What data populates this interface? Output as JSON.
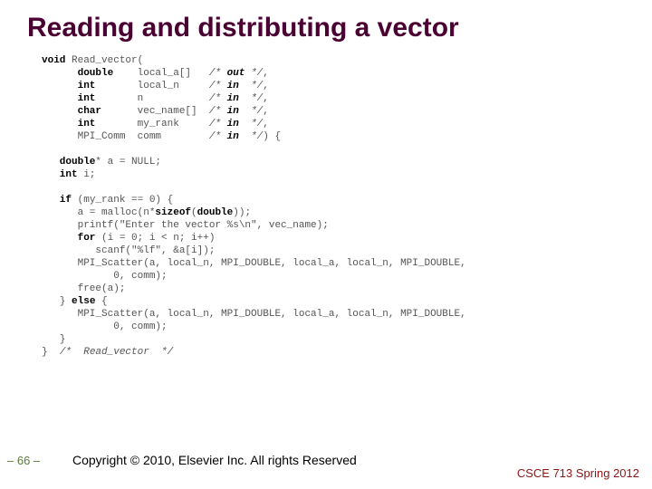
{
  "title": "Reading and distributing a vector",
  "code": {
    "l1a": "void",
    "l1b": " Read_vector(",
    "l2a": "      double",
    "l2b": "    local_a[]   ",
    "l2c": "/* ",
    "l2d": "out ",
    "l2e": "*/",
    "l2f": ",",
    "l3a": "      int",
    "l3b": "       local_n     ",
    "l3c": "/* ",
    "l3d": "in  ",
    "l3e": "*/",
    "l3f": ",",
    "l4a": "      int",
    "l4b": "       n           ",
    "l4c": "/* ",
    "l4d": "in  ",
    "l4e": "*/",
    "l4f": ",",
    "l5a": "      char",
    "l5b": "      vec_name[]  ",
    "l5c": "/* ",
    "l5d": "in  ",
    "l5e": "*/",
    "l5f": ",",
    "l6a": "      int",
    "l6b": "       my_rank     ",
    "l6c": "/* ",
    "l6d": "in  ",
    "l6e": "*/",
    "l6f": ",",
    "l7a": "      MPI_Comm  comm        ",
    "l7c": "/* ",
    "l7d": "in  ",
    "l7e": "*/",
    "l7f": ") {",
    "l8": "",
    "l9a": "   double",
    "l9b": "* a = NULL;",
    "l10a": "   int",
    "l10b": " i;",
    "l11": "",
    "l12a": "   if",
    "l12b": " (my_rank == 0) {",
    "l13a": "      a = malloc(n*",
    "l13b": "sizeof",
    "l13c": "(",
    "l13d": "double",
    "l13e": "));",
    "l14": "      printf(\"Enter the vector %s\\n\", vec_name);",
    "l15a": "      for",
    "l15b": " (i = 0; i < n; i++)",
    "l16": "         scanf(\"%lf\", &a[i]);",
    "l17": "      MPI_Scatter(a, local_n, MPI_DOUBLE, local_a, local_n, MPI_DOUBLE,",
    "l18": "            0, comm);",
    "l19": "      free(a);",
    "l20a": "   } ",
    "l20b": "else",
    "l20c": " {",
    "l21": "      MPI_Scatter(a, local_n, MPI_DOUBLE, local_a, local_n, MPI_DOUBLE,",
    "l22": "            0, comm);",
    "l23": "   }",
    "l24a": "}  ",
    "l24b": "/*  Read_vector  */"
  },
  "pagenum": "– 66 –",
  "copyright": "Copyright © 2010, Elsevier Inc. All rights Reserved",
  "course": "CSCE 713 Spring 2012"
}
